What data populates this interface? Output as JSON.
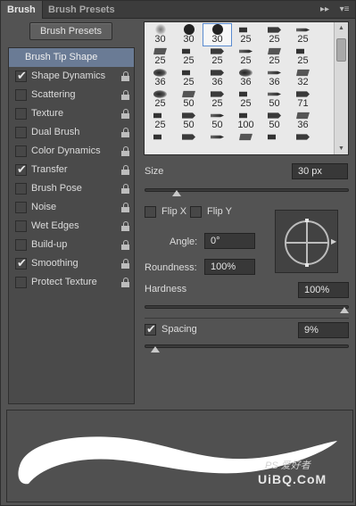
{
  "tabs": [
    {
      "label": "Brush",
      "active": true
    },
    {
      "label": "Brush Presets",
      "active": false
    }
  ],
  "toolbar": {
    "collapse_icon": "double-chevron-right-icon",
    "collapse_glyph": "▸▸",
    "menu_icon": "panel-menu-icon",
    "menu_glyph": "▾≡"
  },
  "presets_button": "Brush Presets",
  "options": [
    {
      "label": "Brush Tip Shape",
      "header": true
    },
    {
      "label": "Shape Dynamics",
      "checked": true,
      "locked": true
    },
    {
      "label": "Scattering",
      "checked": false,
      "locked": true
    },
    {
      "label": "Texture",
      "checked": false,
      "locked": true
    },
    {
      "label": "Dual Brush",
      "checked": false,
      "locked": true
    },
    {
      "label": "Color Dynamics",
      "checked": false,
      "locked": true
    },
    {
      "label": "Transfer",
      "checked": true,
      "locked": true
    },
    {
      "label": "Brush Pose",
      "checked": false,
      "locked": true
    },
    {
      "label": "Noise",
      "checked": false,
      "locked": true
    },
    {
      "label": "Wet Edges",
      "checked": false,
      "locked": true
    },
    {
      "label": "Build-up",
      "checked": false,
      "locked": true
    },
    {
      "label": "Smoothing",
      "checked": true,
      "locked": true
    },
    {
      "label": "Protect Texture",
      "checked": false,
      "locked": true
    }
  ],
  "tips": [
    [
      "30",
      "30",
      "30",
      "25",
      "25",
      "25"
    ],
    [
      "25",
      "25",
      "25",
      "25",
      "25",
      "25"
    ],
    [
      "36",
      "25",
      "36",
      "36",
      "36",
      "32"
    ],
    [
      "25",
      "50",
      "25",
      "25",
      "50",
      "71"
    ],
    [
      "25",
      "50",
      "50",
      "100",
      "50",
      "36"
    ],
    [
      "",
      "",
      "",
      "",
      "",
      ""
    ]
  ],
  "tip_selected": "30",
  "size": {
    "label": "Size",
    "value": "30 px",
    "fraction": 0.14
  },
  "flip_x": {
    "label": "Flip X",
    "checked": false
  },
  "flip_y": {
    "label": "Flip Y",
    "checked": false
  },
  "angle": {
    "label": "Angle:",
    "value": "0°"
  },
  "roundness": {
    "label": "Roundness:",
    "value": "100%"
  },
  "hardness": {
    "label": "Hardness",
    "value": "100%",
    "fraction": 1.0
  },
  "spacing": {
    "label": "Spacing",
    "value": "9%",
    "checked": true,
    "fraction": 0.03
  },
  "watermark": {
    "top": "PS 爱好者",
    "bottom": "UiBQ.CoM"
  }
}
